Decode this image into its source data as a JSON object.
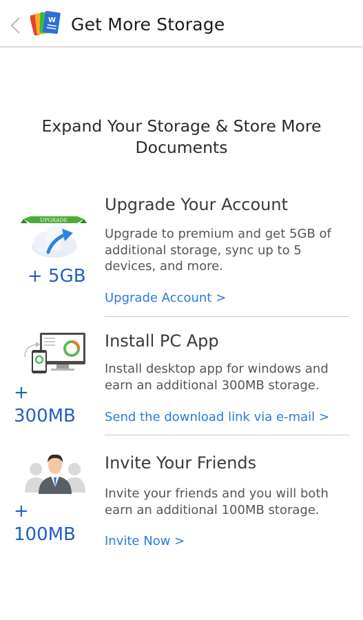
{
  "header": {
    "title": "Get More Storage"
  },
  "headline": {
    "line1": "Expand Your Storage & Store More",
    "line2": "Documents"
  },
  "sections": [
    {
      "illustration": "upgrade-cloud-icon",
      "ribbon_text": "UPGRADE",
      "bonus": "+ 5GB",
      "title": "Upgrade Your Account",
      "description": "Upgrade to premium and get 5GB of additional storage, sync up to 5 devices, and more.",
      "link": "Upgrade Account >"
    },
    {
      "illustration": "pc-app-icon",
      "bonus_line1": "+",
      "bonus_line2": "300MB",
      "title": "Install PC App",
      "description": "Install desktop app for windows and earn an additional 300MB storage.",
      "link": "Send the download link via e-mail >"
    },
    {
      "illustration": "invite-friends-icon",
      "bonus_line1": "+",
      "bonus_line2": "100MB",
      "title": "Invite Your Friends",
      "description": "Invite your friends and you will both earn an additional 100MB storage.",
      "link": "Invite Now >"
    }
  ],
  "colors": {
    "accent_link": "#2a7bd8",
    "bonus_blue": "#1f5fc4",
    "ribbon_green": "#4cab3b",
    "divider": "#c8c8c8"
  }
}
